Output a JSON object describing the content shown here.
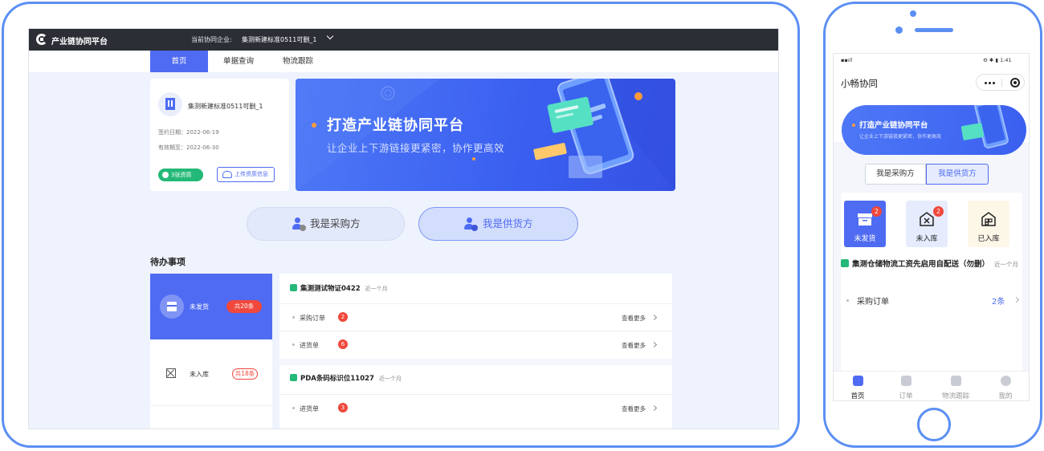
{
  "tablet": {
    "app_name": "产业链协同平台",
    "enterprise_label": "当前协同企业:",
    "enterprise_value": "集测新建标准0511可删_1",
    "nav": [
      "首页",
      "单据查询",
      "物流跟踪"
    ],
    "company": {
      "name": "集测新建标准0511可删_1",
      "sign_date": "签约日期：2022-06-19",
      "expire_date": "有效期至：2022-06-30",
      "cert_badge": "3张资质",
      "upload_label": "上传资质信息"
    },
    "banner": {
      "title": "打造产业链协同平台",
      "subtitle": "让企业上下游链接更紧密，协作更高效"
    },
    "roles": {
      "buyer": "我是采购方",
      "supplier": "我是供货方"
    },
    "todo": {
      "title": "待办事项",
      "left": [
        {
          "label": "未发货",
          "count": "共20条",
          "active": true
        },
        {
          "label": "未入库",
          "count": "共18条",
          "active": false
        }
      ],
      "groups": [
        {
          "title": "集测测试物证0422",
          "tag": "近一个月",
          "rows": [
            {
              "label": "采购订单",
              "count": "2",
              "more": "查看更多"
            },
            {
              "label": "进货单",
              "count": "6",
              "more": "查看更多"
            }
          ]
        },
        {
          "title": "PDA条码标识位11027",
          "tag": "近一个月",
          "rows": [
            {
              "label": "进货单",
              "count": "3",
              "more": "查看更多"
            }
          ]
        }
      ]
    }
  },
  "phone": {
    "status_time": "1:41",
    "title": "小畅协同",
    "banner": {
      "title": "打造产业链协同平台",
      "subtitle": "让企业上下游链接更紧密，协作更高效"
    },
    "segments": [
      "我是采购方",
      "我是供货方"
    ],
    "tiles": [
      {
        "label": "未发货",
        "badge": "2"
      },
      {
        "label": "未入库",
        "badge": "2"
      },
      {
        "label": "已入库",
        "badge": ""
      }
    ],
    "warehouse": {
      "title": "集测仓储物流工资先启用自配送（勿删）",
      "tag": "近一个月"
    },
    "row": {
      "label": "采购订单",
      "count": "2条"
    },
    "tabbar": [
      "首页",
      "订单",
      "物流跟踪",
      "我的"
    ]
  },
  "colors": {
    "primary": "#4f6bf2",
    "frame": "#5b8ff3",
    "badge_red": "#f0483c",
    "badge_green": "#24b978",
    "topbar": "#2c2e36"
  }
}
